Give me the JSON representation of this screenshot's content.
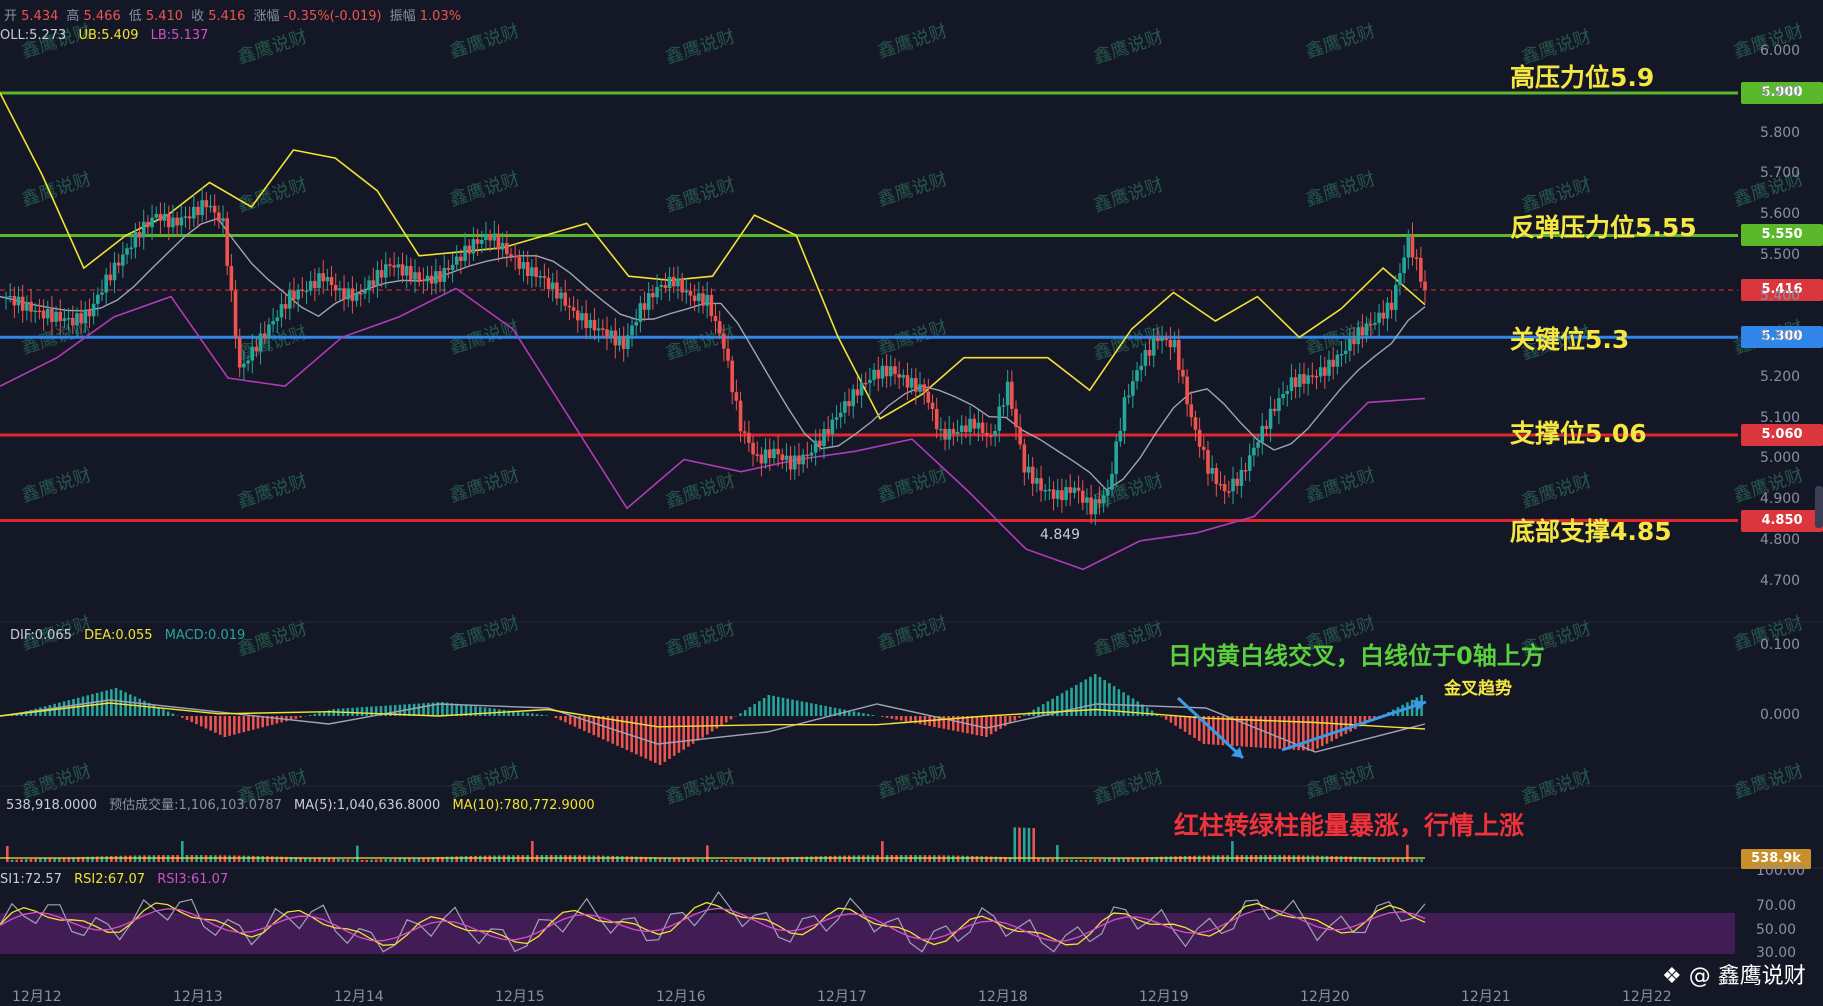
{
  "header": {
    "ohlc": [
      {
        "label": "开",
        "value": "5.434"
      },
      {
        "label": "高",
        "value": "5.466"
      },
      {
        "label": "低",
        "value": "5.410"
      },
      {
        "label": "收",
        "value": "5.416"
      },
      {
        "label": "涨幅",
        "value": "-0.35%(-0.019)"
      },
      {
        "label": "振幅",
        "value": "1.03%"
      }
    ],
    "boll": {
      "mid": "OLL:5.273",
      "ub": "UB:5.409",
      "lb": "LB:5.137"
    },
    "macd": {
      "dif": "DIF:0.065",
      "dea": "DEA:0.055",
      "macd": "MACD:0.019"
    },
    "vol": {
      "v": "538,918.0000",
      "est": "预估成交量:1,106,103.0787",
      "ma5": "MA(5):1,040,636.8000",
      "ma10": "MA(10):780,772.9000"
    },
    "rsi": {
      "r1": "SI1:72.57",
      "r2": "RSI2:67.07",
      "r3": "RSI3:61.07"
    }
  },
  "annotations": {
    "high_resistance": "高压力位5.9",
    "rebound_resistance": "反弹压力位5.55",
    "key_level": "关键位5.3",
    "support": "支撑位5.06",
    "bottom_support": "底部支撑4.85",
    "macd_note": "日内黄白线交叉，白线位于0轴上方",
    "golden_cross": "金叉趋势",
    "volume_note": "红柱转绿柱能量暴涨，行情上涨",
    "low_mark": "4.849"
  },
  "price_tags": [
    {
      "value": "5.900",
      "color": "#5ab82a"
    },
    {
      "value": "5.550",
      "color": "#5ab82a"
    },
    {
      "value": "5.416",
      "color": "#d9363e"
    },
    {
      "value": "5.300",
      "color": "#2f86e8"
    },
    {
      "value": "5.060",
      "color": "#d9363e"
    },
    {
      "value": "4.850",
      "color": "#d9363e"
    }
  ],
  "price_axis": [
    "6.000",
    "5.900",
    "5.800",
    "5.700",
    "5.600",
    "5.500",
    "5.400",
    "5.300",
    "5.200",
    "5.100",
    "5.000",
    "4.900",
    "4.800",
    "4.700"
  ],
  "macd_axis": [
    "0.100",
    "0.000"
  ],
  "vol_tag": "538.9k",
  "rsi_axis": [
    "100.00",
    "70.00",
    "50.00",
    "30.00"
  ],
  "dates": [
    "12月12",
    "12月13",
    "12月14",
    "12月15",
    "12月16",
    "12月17",
    "12月18",
    "12月19",
    "12月20",
    "12月21",
    "12月22"
  ],
  "watermark": "鑫鹰说财",
  "brand": "@ 鑫鹰说财",
  "colors": {
    "bg": "#141726",
    "up": "#26a69a",
    "down": "#ef5350",
    "green_line": "#5ab82a",
    "blue_line": "#2f86e8",
    "red_line": "#e0262d",
    "yellow": "#f2e232",
    "gray": "#9fa4b4",
    "purple": "#b23ab5",
    "rsi_band": "#4a1f5e",
    "ann_yellow": "#f5e642",
    "ann_green": "#5ad13c",
    "ann_red": "#f0323a"
  },
  "chart_data": {
    "type": "candlestick",
    "price_range": [
      4.65,
      6.03
    ],
    "levels": [
      {
        "name": "高压力位",
        "value": 5.9
      },
      {
        "name": "反弹压力位",
        "value": 5.55
      },
      {
        "name": "关键位",
        "value": 5.3
      },
      {
        "name": "支撑位",
        "value": 5.06
      },
      {
        "name": "底部支撑",
        "value": 4.85
      }
    ],
    "last_close": 5.416,
    "close_path": [
      5.4,
      5.38,
      5.36,
      5.35,
      5.34,
      5.36,
      5.44,
      5.5,
      5.56,
      5.6,
      5.58,
      5.6,
      5.63,
      5.58,
      5.22,
      5.28,
      5.34,
      5.4,
      5.42,
      5.45,
      5.41,
      5.4,
      5.44,
      5.48,
      5.46,
      5.44,
      5.45,
      5.49,
      5.53,
      5.55,
      5.51,
      5.47,
      5.45,
      5.41,
      5.36,
      5.33,
      5.31,
      5.28,
      5.37,
      5.42,
      5.44,
      5.4,
      5.39,
      5.28,
      5.08,
      5.0,
      5.02,
      4.99,
      5.01,
      5.06,
      5.12,
      5.17,
      5.21,
      5.22,
      5.19,
      5.17,
      5.06,
      5.07,
      5.09,
      5.05,
      5.18,
      4.98,
      4.93,
      4.91,
      4.93,
      4.88,
      4.92,
      5.14,
      5.24,
      5.3,
      5.28,
      5.1,
      4.98,
      4.92,
      4.96,
      5.05,
      5.13,
      5.19,
      5.2,
      5.22,
      5.26,
      5.31,
      5.34,
      5.38,
      5.54,
      5.42
    ],
    "boll_ub_path": [
      5.9,
      5.7,
      5.47,
      5.55,
      5.6,
      5.68,
      5.62,
      5.76,
      5.74,
      5.66,
      5.5,
      5.51,
      5.52,
      5.55,
      5.58,
      5.45,
      5.44,
      5.45,
      5.6,
      5.55,
      5.3,
      5.1,
      5.16,
      5.25,
      5.25,
      5.25,
      5.17,
      5.32,
      5.41,
      5.34,
      5.4,
      5.3,
      5.37,
      5.47,
      5.38
    ],
    "boll_lb_path": [
      5.18,
      5.25,
      5.35,
      5.4,
      5.2,
      5.18,
      5.3,
      5.35,
      5.42,
      5.32,
      5.1,
      4.88,
      5.0,
      4.97,
      5.0,
      5.02,
      5.05,
      4.92,
      4.78,
      4.73,
      4.8,
      4.82,
      4.86,
      5.0,
      5.14,
      5.15
    ],
    "macd_dif": [
      0.0,
      0.04,
      -0.03,
      0.01,
      0.02,
      0.0,
      -0.07,
      0.03,
      0.0,
      -0.03,
      0.06,
      -0.04,
      -0.05,
      0.03
    ],
    "volume_ma10": 780772.9,
    "rsi": [
      72.57,
      67.07,
      61.07
    ]
  }
}
